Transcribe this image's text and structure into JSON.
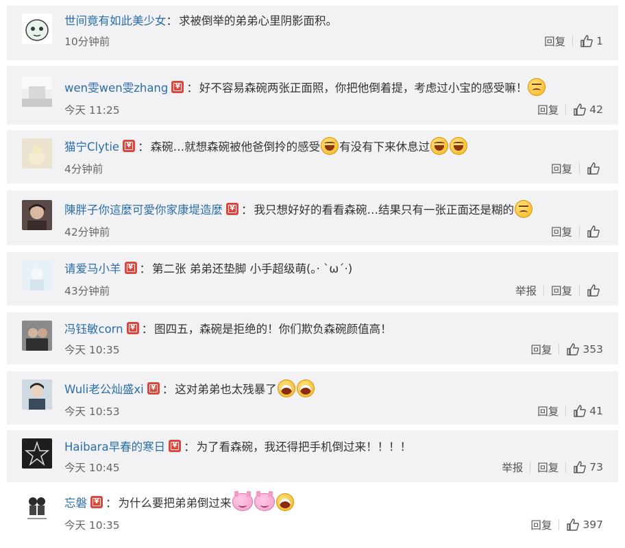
{
  "ui": {
    "reply": "回复",
    "report": "举报"
  },
  "comments": [
    {
      "username": "世间竟有如此美少女",
      "text": "求被倒举的弟弟心里阴影面积。",
      "time": "10分钟前",
      "likes": "1",
      "vip": false
    },
    {
      "username": "wen雯wen雯zhang",
      "text": "好不容易森碗两张正面照，你把他倒着提，考虑过小宝的感受嘛！",
      "time": "今天 11:25",
      "likes": "42",
      "vip": true
    },
    {
      "username": "猫宁Clytie",
      "text_a": "森碗…就想森碗被他爸倒拎的感受",
      "text_b": "有没有下来休息过",
      "time": "4分钟前",
      "likes": "",
      "vip": true
    },
    {
      "username": "陳胖子你這麼可愛你家康堤造麼",
      "text": "我只想好好的看看森碗…结果只有一张正面还是糊的",
      "time": "42分钟前",
      "likes": "",
      "vip": true
    },
    {
      "username": "请爱马小羊",
      "text": "第二张 弟弟还垫脚 小手超级萌(。· ˋω´·)",
      "time": "43分钟前",
      "likes": "",
      "vip": true
    },
    {
      "username": "冯钰敏corn",
      "text": "图四五，森碗是拒绝的！你们欺负森碗颜值高！",
      "time": "今天 10:35",
      "likes": "353",
      "vip": true
    },
    {
      "username": "Wuli老公灿盛xi",
      "text": "这对弟弟也太残暴了",
      "time": "今天 10:53",
      "likes": "41",
      "vip": true
    },
    {
      "username": "Haibara早春的寒日",
      "text": "为了看森碗，我还得把手机倒过来！！！！",
      "time": "今天 10:45",
      "likes": "73",
      "vip": true
    },
    {
      "username": "忘磐",
      "text": "为什么要把弟弟倒过来",
      "time": "今天 10:35",
      "likes": "397",
      "vip": true
    }
  ]
}
